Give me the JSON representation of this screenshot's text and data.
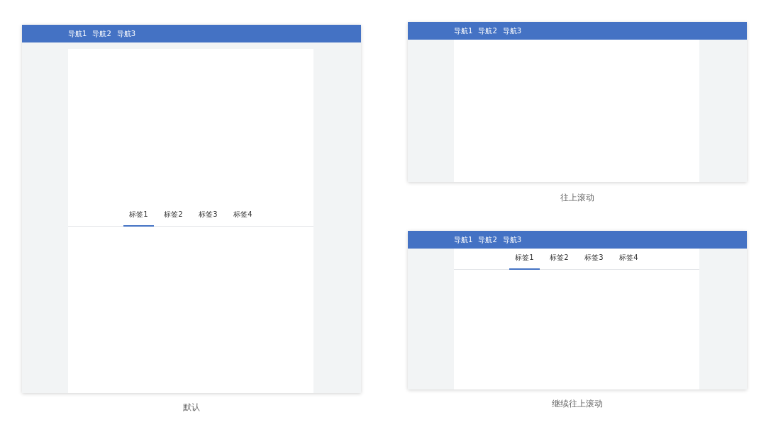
{
  "mockups": [
    {
      "kind": "default",
      "nav": [
        "导航1",
        "导航2",
        "导航3"
      ],
      "tabs": [
        {
          "label": "标签1",
          "selected": true
        },
        {
          "label": "标签2",
          "selected": false
        },
        {
          "label": "标签3",
          "selected": false
        },
        {
          "label": "标签4",
          "selected": false
        }
      ],
      "caption": "默认"
    },
    {
      "kind": "scrolled",
      "nav": [
        "导航1",
        "导航2",
        "导航3"
      ],
      "caption": "往上滚动"
    },
    {
      "kind": "sticky",
      "nav": [
        "导航1",
        "导航2",
        "导航3"
      ],
      "tabs": [
        {
          "label": "标签1",
          "selected": true
        },
        {
          "label": "标签2",
          "selected": false
        },
        {
          "label": "标签3",
          "selected": false
        },
        {
          "label": "标签4",
          "selected": false
        }
      ],
      "caption": "继续往上滚动"
    }
  ]
}
